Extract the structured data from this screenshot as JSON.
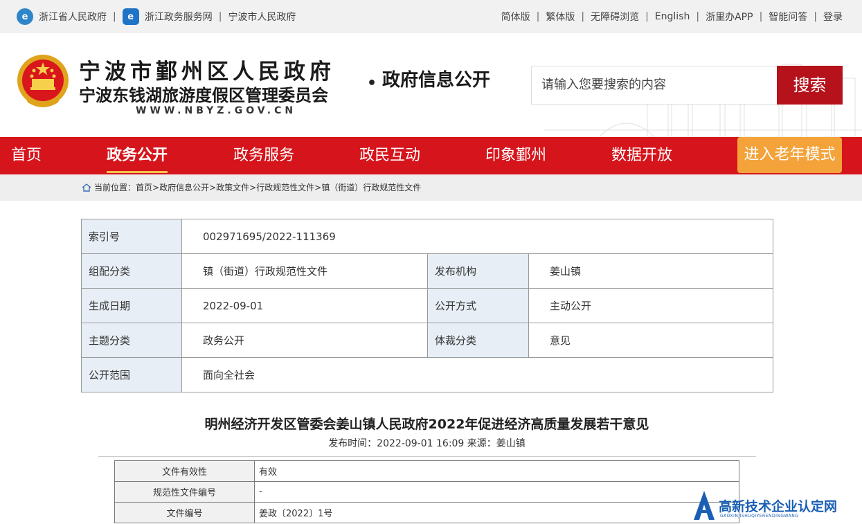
{
  "topbar": {
    "left_links": [
      "浙江省人民政府",
      "浙江政务服务网",
      "宁波市人民政府"
    ],
    "right_links": [
      "简体版",
      "繁体版",
      "无障碍浏览",
      "English",
      "浙里办APP",
      "智能问答",
      "登录"
    ]
  },
  "header": {
    "title_line1": "宁波市鄞州区人民政府",
    "title_line2": "宁波东钱湖旅游度假区管理委员会",
    "url": "WWW.NBYZ.GOV.CN",
    "dot": "•",
    "subtitle": "政府信息公开",
    "search": {
      "placeholder": "请输入您要搜索的内容",
      "button": "搜索"
    }
  },
  "nav": {
    "items": [
      "首页",
      "政务公开",
      "政务服务",
      "政民互动",
      "印象鄞州",
      "数据开放"
    ],
    "active_index": 1,
    "old_mode": "进入老年模式"
  },
  "breadcrumb": {
    "label": "当前位置：",
    "path": "首页>政府信息公开>政策文件>行政规范性文件>镇（街道）行政规范性文件"
  },
  "meta": {
    "index_no_label": "索引号",
    "index_no": "002971695/2022-111369",
    "category_label": "组配分类",
    "category": "镇（街道）行政规范性文件",
    "publisher_label": "发布机构",
    "publisher": "姜山镇",
    "date_label": "生成日期",
    "date": "2022-09-01",
    "open_mode_label": "公开方式",
    "open_mode": "主动公开",
    "topic_label": "主题分类",
    "topic": "政务公开",
    "genre_label": "体裁分类",
    "genre": "意见",
    "scope_label": "公开范围",
    "scope": "面向全社会"
  },
  "article": {
    "title": "明州经济开发区管委会姜山镇人民政府2022年促进经济高质量发展若干意见",
    "meta": "发布时间：2022-09-01 16:09 来源：姜山镇"
  },
  "doc_table": {
    "rows": [
      {
        "key": "文件有效性",
        "value": "有效"
      },
      {
        "key": "规范性文件编号",
        "value": "-"
      },
      {
        "key": "文件编号",
        "value": "姜政〔2022〕1号"
      }
    ]
  },
  "watermark": {
    "text": "高新技术企业认定网",
    "pinyin": "GAOXINJISHUQIYERENDINGWANG"
  },
  "colors": {
    "nav_red": "#d6141b",
    "search_red": "#b5121b",
    "old_mode_orange": "#f4a33a",
    "table_key_bg": "#e7eef5"
  }
}
